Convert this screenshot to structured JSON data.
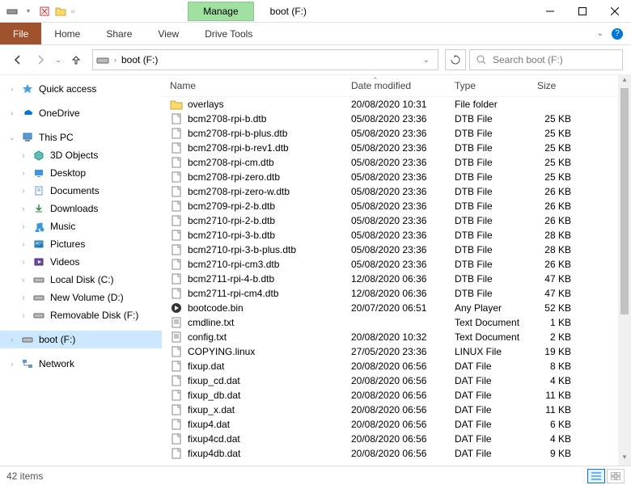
{
  "window": {
    "title": "boot (F:)",
    "manage_tab": "Manage",
    "drive_tools": "Drive Tools"
  },
  "ribbon": {
    "file": "File",
    "tabs": [
      "Home",
      "Share",
      "View"
    ]
  },
  "nav": {
    "address": "boot (F:)",
    "search_placeholder": "Search boot (F:)"
  },
  "sidebar": {
    "quick_access": "Quick access",
    "onedrive": "OneDrive",
    "this_pc": "This PC",
    "pc_children": [
      "3D Objects",
      "Desktop",
      "Documents",
      "Downloads",
      "Music",
      "Pictures",
      "Videos",
      "Local Disk (C:)",
      "New Volume (D:)",
      "Removable Disk (F:)"
    ],
    "boot": "boot (F:)",
    "network": "Network"
  },
  "columns": {
    "name": "Name",
    "date": "Date modified",
    "type": "Type",
    "size": "Size"
  },
  "files": [
    {
      "name": "overlays",
      "date": "20/08/2020 10:31",
      "type": "File folder",
      "size": "",
      "icon": "folder"
    },
    {
      "name": "bcm2708-rpi-b.dtb",
      "date": "05/08/2020 23:36",
      "type": "DTB File",
      "size": "25 KB",
      "icon": "file"
    },
    {
      "name": "bcm2708-rpi-b-plus.dtb",
      "date": "05/08/2020 23:36",
      "type": "DTB File",
      "size": "25 KB",
      "icon": "file"
    },
    {
      "name": "bcm2708-rpi-b-rev1.dtb",
      "date": "05/08/2020 23:36",
      "type": "DTB File",
      "size": "25 KB",
      "icon": "file"
    },
    {
      "name": "bcm2708-rpi-cm.dtb",
      "date": "05/08/2020 23:36",
      "type": "DTB File",
      "size": "25 KB",
      "icon": "file"
    },
    {
      "name": "bcm2708-rpi-zero.dtb",
      "date": "05/08/2020 23:36",
      "type": "DTB File",
      "size": "25 KB",
      "icon": "file"
    },
    {
      "name": "bcm2708-rpi-zero-w.dtb",
      "date": "05/08/2020 23:36",
      "type": "DTB File",
      "size": "26 KB",
      "icon": "file"
    },
    {
      "name": "bcm2709-rpi-2-b.dtb",
      "date": "05/08/2020 23:36",
      "type": "DTB File",
      "size": "26 KB",
      "icon": "file"
    },
    {
      "name": "bcm2710-rpi-2-b.dtb",
      "date": "05/08/2020 23:36",
      "type": "DTB File",
      "size": "26 KB",
      "icon": "file"
    },
    {
      "name": "bcm2710-rpi-3-b.dtb",
      "date": "05/08/2020 23:36",
      "type": "DTB File",
      "size": "28 KB",
      "icon": "file"
    },
    {
      "name": "bcm2710-rpi-3-b-plus.dtb",
      "date": "05/08/2020 23:36",
      "type": "DTB File",
      "size": "28 KB",
      "icon": "file"
    },
    {
      "name": "bcm2710-rpi-cm3.dtb",
      "date": "05/08/2020 23:36",
      "type": "DTB File",
      "size": "26 KB",
      "icon": "file"
    },
    {
      "name": "bcm2711-rpi-4-b.dtb",
      "date": "12/08/2020 06:36",
      "type": "DTB File",
      "size": "47 KB",
      "icon": "file"
    },
    {
      "name": "bcm2711-rpi-cm4.dtb",
      "date": "12/08/2020 06:36",
      "type": "DTB File",
      "size": "47 KB",
      "icon": "file"
    },
    {
      "name": "bootcode.bin",
      "date": "20/07/2020 06:51",
      "type": "Any Player",
      "size": "52 KB",
      "icon": "bin"
    },
    {
      "name": "cmdline.txt",
      "date": "",
      "type": "Text Document",
      "size": "1 KB",
      "icon": "txt"
    },
    {
      "name": "config.txt",
      "date": "20/08/2020 10:32",
      "type": "Text Document",
      "size": "2 KB",
      "icon": "txt"
    },
    {
      "name": "COPYING.linux",
      "date": "27/05/2020 23:36",
      "type": "LINUX File",
      "size": "19 KB",
      "icon": "file"
    },
    {
      "name": "fixup.dat",
      "date": "20/08/2020 06:56",
      "type": "DAT File",
      "size": "8 KB",
      "icon": "file"
    },
    {
      "name": "fixup_cd.dat",
      "date": "20/08/2020 06:56",
      "type": "DAT File",
      "size": "4 KB",
      "icon": "file"
    },
    {
      "name": "fixup_db.dat",
      "date": "20/08/2020 06:56",
      "type": "DAT File",
      "size": "11 KB",
      "icon": "file"
    },
    {
      "name": "fixup_x.dat",
      "date": "20/08/2020 06:56",
      "type": "DAT File",
      "size": "11 KB",
      "icon": "file"
    },
    {
      "name": "fixup4.dat",
      "date": "20/08/2020 06:56",
      "type": "DAT File",
      "size": "6 KB",
      "icon": "file"
    },
    {
      "name": "fixup4cd.dat",
      "date": "20/08/2020 06:56",
      "type": "DAT File",
      "size": "4 KB",
      "icon": "file"
    },
    {
      "name": "fixup4db.dat",
      "date": "20/08/2020 06:56",
      "type": "DAT File",
      "size": "9 KB",
      "icon": "file"
    }
  ],
  "status": {
    "count": "42 items"
  }
}
